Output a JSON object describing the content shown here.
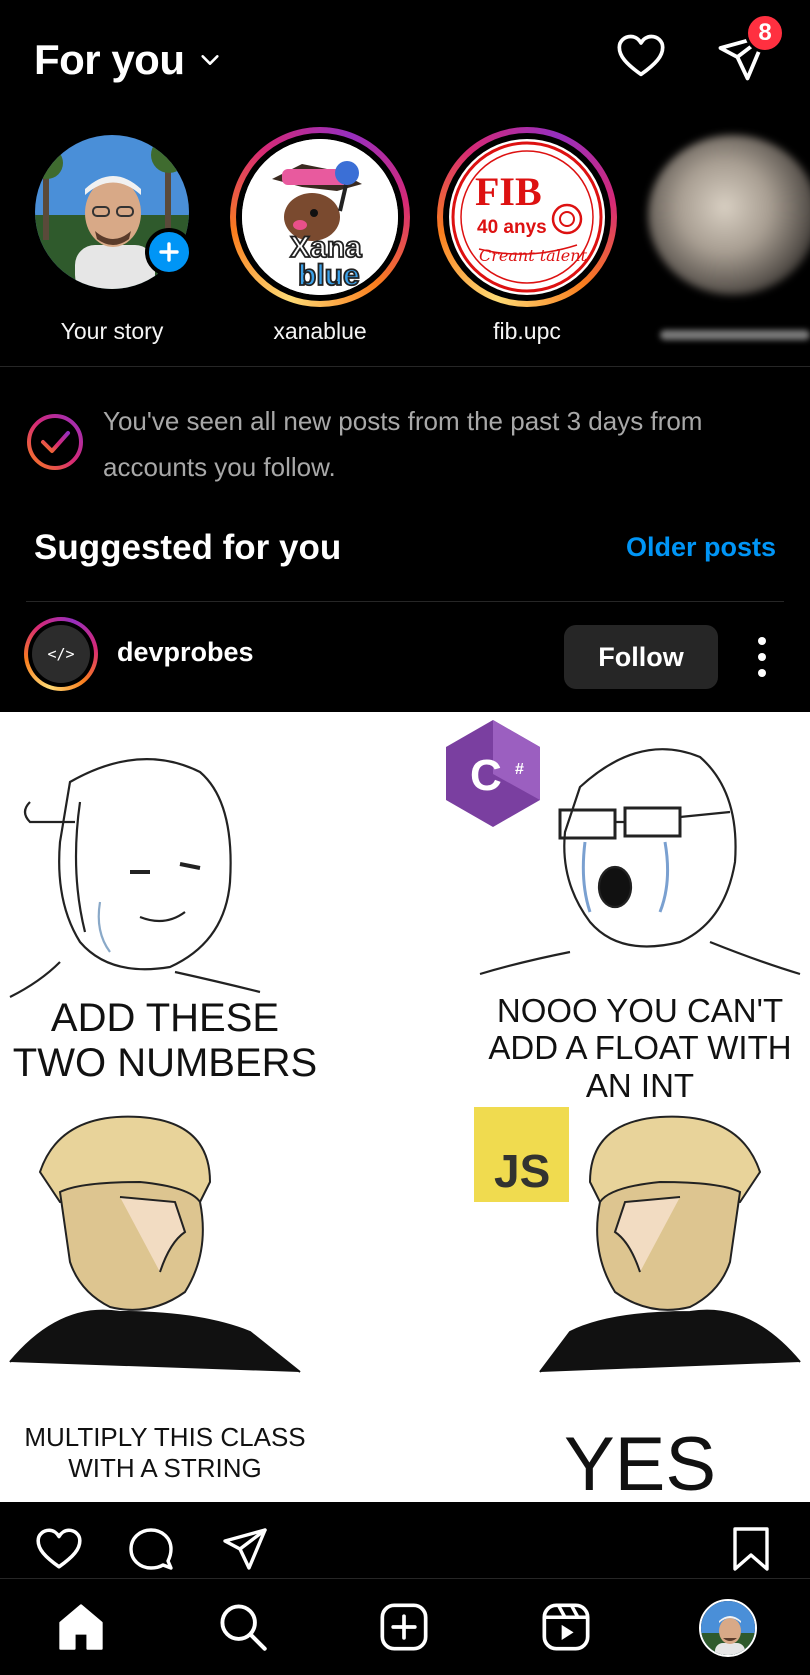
{
  "header": {
    "title": "For you",
    "notification_count": "8"
  },
  "stories": [
    {
      "label": "Your story"
    },
    {
      "label": "xanablue",
      "logo_top": "Xana",
      "logo_bottom": "blue"
    },
    {
      "label": "fib.upc",
      "logo_top": "FIB",
      "logo_mid": "40 anys",
      "logo_bottom": "Creant talent"
    },
    {
      "label": ""
    }
  ],
  "caught_up": {
    "message": "You've seen all new posts from the past 3 days from accounts you follow."
  },
  "suggested": {
    "title": "Suggested for you",
    "older_link": "Older posts"
  },
  "post": {
    "avatar_glyph": "</>",
    "username": "devprobes",
    "follow_label": "Follow",
    "meme": {
      "caption_1": "ADD THESE TWO NUMBERS",
      "caption_2": "NOOO YOU CAN'T ADD A FLOAT WITH AN INT",
      "caption_3": "MULTIPLY THIS CLASS WITH A STRING",
      "caption_4": "YES",
      "csharp_badge": "C#",
      "js_badge": "JS"
    }
  },
  "colors": {
    "accent": "#0095f6",
    "badge": "#ff3040",
    "background": "#000000"
  },
  "icons": {
    "header": [
      "heart-icon",
      "direct-message-icon"
    ],
    "actions": [
      "like-icon",
      "comment-icon",
      "share-icon",
      "bookmark-icon"
    ],
    "tabs": [
      "home-icon",
      "search-icon",
      "create-icon",
      "reels-icon",
      "profile-avatar"
    ]
  }
}
